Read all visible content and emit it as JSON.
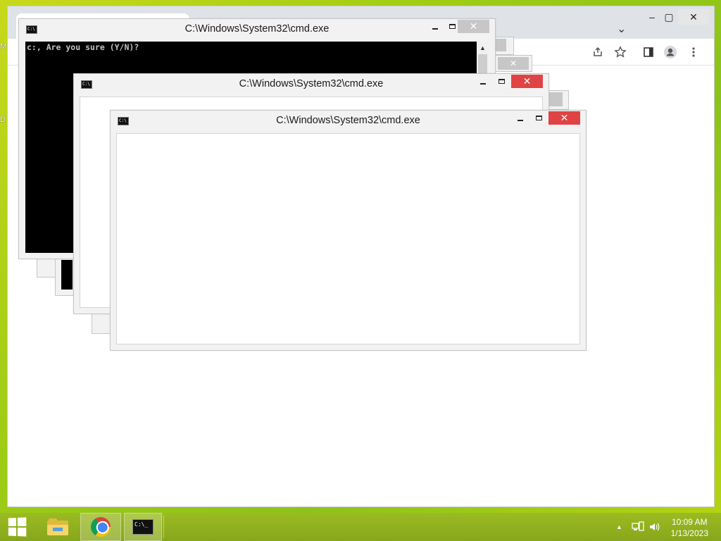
{
  "desktop": {
    "icon_fragments": [
      "M",
      "D"
    ]
  },
  "browser": {
    "caption": {
      "minimize": "–",
      "maximize": "▢",
      "close": "✕"
    },
    "tab_search_glyph": "⌄",
    "toolbar_icons": [
      "share-icon",
      "star-icon",
      "side-panel-icon",
      "profile-icon",
      "menu-icon"
    ]
  },
  "cmd_windows": [
    {
      "title": "C:\\Windows\\System32\\cmd.exe",
      "console_text": "c:, Are you sure (Y/N)?"
    },
    {
      "title": "C:\\Windows\\System32\\cmd.exe"
    },
    {
      "title": "C:\\Windows\\System32\\cmd.exe"
    }
  ],
  "window_buttons": {
    "close": "✕"
  },
  "taskbar": {
    "items": [
      "start-button",
      "file-explorer",
      "google-chrome",
      "command-prompt"
    ],
    "cmd_icon_text": "C:\\_",
    "tray": {
      "arrow": "▲"
    },
    "clock": {
      "time": "10:09 AM",
      "date": "1/13/2023"
    }
  },
  "colors": {
    "desktop": "#9fcc15",
    "taskbar": "#8fae1f",
    "close_active": "#e04343",
    "console_bg": "#000000"
  }
}
